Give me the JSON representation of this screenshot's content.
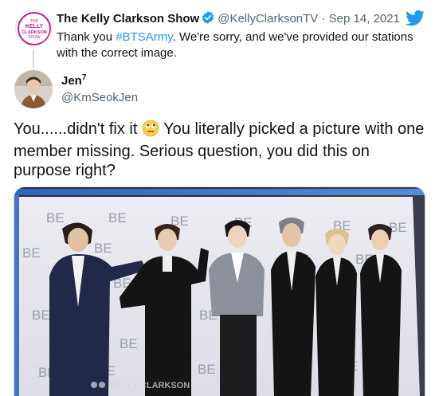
{
  "quoted_tweet": {
    "avatar_text": [
      "THE",
      "KELLY",
      "CLARKSON",
      "SHOW"
    ],
    "display_name": "The Kelly Clarkson Show",
    "handle": "@KellyClarksonTV",
    "separator": "·",
    "date": "Sep 14, 2021",
    "text_before": "Thank you ",
    "hashtag": "#BTSArmy",
    "text_after": ". We're sorry, and we've provided our stations with the correct image.",
    "icons": {
      "verified": "verified-badge-icon",
      "platform": "twitter-bird-icon"
    }
  },
  "tweet": {
    "display_name": "Jen",
    "name_superscript": "7",
    "handle": "@KmSeokJen",
    "text_part1": "You......didn't fix it",
    "emoji": "face-with-rolling-eyes-emoji",
    "text_part2": " You literally picked a picture with one member missing. Serious question, you did this on purpose right?"
  },
  "photo": {
    "backdrop_texts": [
      "BE",
      "BE",
      "BE",
      "BE",
      "BE",
      "BE",
      "BE",
      "BE",
      "BE",
      "BE",
      "BE",
      "BE",
      "BE",
      "BE",
      "BE",
      "BE",
      "BE",
      "BE"
    ],
    "tv_watermark": "KELLY CLARKSON"
  },
  "colors": {
    "accent": "#1d9bf0",
    "secondary_text": "#536471",
    "primary_text": "#0f1419"
  }
}
